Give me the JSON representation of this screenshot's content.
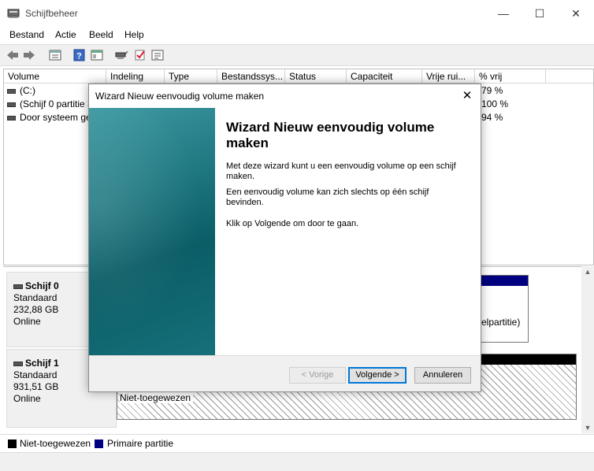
{
  "window": {
    "title": "Schijfbeheer",
    "minimize": "—",
    "maximize": "☐",
    "close": "✕"
  },
  "menu": [
    "Bestand",
    "Actie",
    "Beeld",
    "Help"
  ],
  "toolbar_icons": [
    "back-arrow-icon",
    "forward-arrow-icon",
    "properties-icon",
    "help-icon",
    "console-icon",
    "connect-icon",
    "check-icon",
    "settings-icon"
  ],
  "columns": [
    "Volume",
    "Indeling",
    "Type",
    "Bestandssys...",
    "Status",
    "Capaciteit",
    "Vrije rui...",
    "% vrij"
  ],
  "volumes": [
    {
      "name": "(C:)",
      "free_pct": "79 %"
    },
    {
      "name": "(Schijf 0 partitie 3",
      "free_pct": "100 %"
    },
    {
      "name": "Door systeem ge",
      "free_pct": "94 %"
    }
  ],
  "disks": [
    {
      "name": "Schijf 0",
      "type": "Standaard",
      "size": "232,88 GB",
      "state": "Online",
      "partition_hint": "celpartitie)"
    },
    {
      "name": "Schijf 1",
      "type": "Standaard",
      "size": "931,51 GB",
      "state": "Online",
      "partition_label": "Niet-toegewezen"
    }
  ],
  "legend": [
    {
      "label": "Niet-toegewezen",
      "color": "#000000"
    },
    {
      "label": "Primaire partitie",
      "color": "#000080"
    }
  ],
  "dialog": {
    "title": "Wizard Nieuw eenvoudig volume maken",
    "heading": "Wizard Nieuw eenvoudig volume maken",
    "paragraphs": [
      "Met deze wizard kunt u een eenvoudig volume op een schijf maken.",
      "Een eenvoudig volume kan zich slechts op één schijf bevinden.",
      "Klik op Volgende om door te gaan."
    ],
    "buttons": {
      "back": "< Vorige",
      "next": "Volgende >",
      "cancel": "Annuleren"
    }
  },
  "colors": {
    "accent": "#0078d7",
    "banner": "#0b5d66",
    "primary_partition": "#000080"
  }
}
